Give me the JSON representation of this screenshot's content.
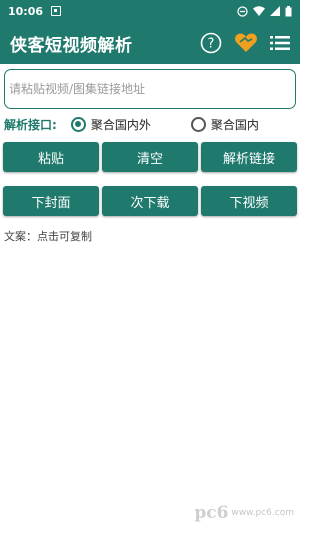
{
  "status_bar": {
    "time": "10:06",
    "icons": [
      "sim-icon",
      "do-not-disturb-icon",
      "wifi-icon",
      "signal-icon",
      "battery-icon"
    ]
  },
  "app_bar": {
    "title": "侠客短视频解析",
    "help_icon": "?",
    "icons": [
      "help-icon",
      "heart-icon",
      "menu-list-icon"
    ]
  },
  "input": {
    "placeholder": "请粘贴视频/图集链接地址",
    "value": ""
  },
  "api": {
    "label": "解析接口:",
    "options": [
      "聚合国内外",
      "聚合国内"
    ],
    "selected": "聚合国内外"
  },
  "buttons_row1": {
    "paste": "粘贴",
    "clear": "清空",
    "parse": "解析链接"
  },
  "buttons_row2": {
    "cover": "下封面",
    "download": "次下载",
    "video": "下视频"
  },
  "copy_hint": "文案：点击可复制",
  "watermark": {
    "logo": "pc6",
    "url": "www.pc6.com"
  },
  "colors": {
    "primary": "#1f7a6d",
    "heart": "#f0a020"
  }
}
